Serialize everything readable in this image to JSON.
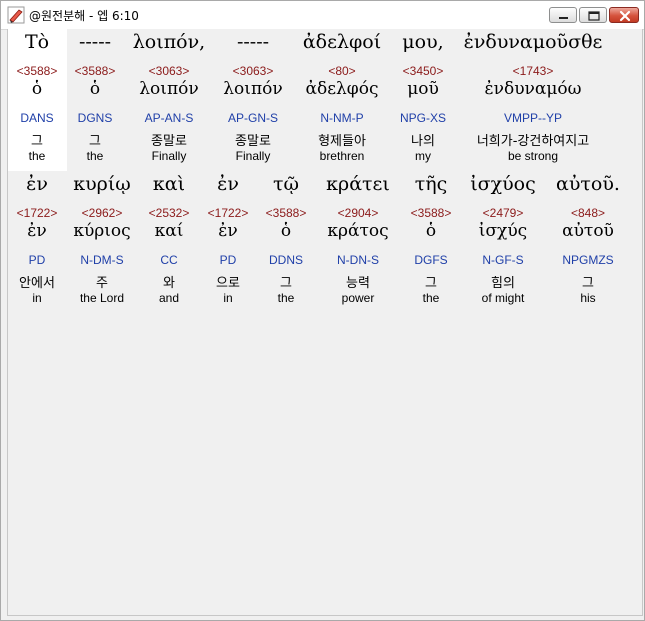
{
  "window": {
    "title": "@원전분해 - 엡 6:10"
  },
  "rows": [
    {
      "words": [
        {
          "greek": "Τὸ",
          "strong": "<3588>",
          "lemma": "ὁ",
          "parse": "DANS",
          "korean": "그",
          "english": "the"
        },
        {
          "greek": "-----",
          "strong": "<3588>",
          "lemma": "ὁ",
          "parse": "DGNS",
          "korean": "그",
          "english": "the"
        },
        {
          "greek": "λοιπόν,",
          "strong": "<3063>",
          "lemma": "λοιπόν",
          "parse": "AP-AN-S",
          "korean": "종말로",
          "english": "Finally"
        },
        {
          "greek": "-----",
          "strong": "<3063>",
          "lemma": "λοιπόν",
          "parse": "AP-GN-S",
          "korean": "종말로",
          "english": "Finally"
        },
        {
          "greek": "ἀδελφοί",
          "strong": "<80>",
          "lemma": "ἀδελφός",
          "parse": "N-NM-P",
          "korean": "형제들아",
          "english": "brethren"
        },
        {
          "greek": "μου,",
          "strong": "<3450>",
          "lemma": "μοῦ",
          "parse": "NPG-XS",
          "korean": "나의",
          "english": "my"
        },
        {
          "greek": "ἐνδυναμοῦσθε",
          "strong": "<1743>",
          "lemma": "ἐνδυναμόω",
          "parse": "VMPP--YP",
          "korean": "너희가-강건하여지고",
          "english": "be strong"
        }
      ]
    },
    {
      "words": [
        {
          "greek": "ἐν",
          "strong": "<1722>",
          "lemma": "ἐν",
          "parse": "PD",
          "korean": "안에서",
          "english": "in"
        },
        {
          "greek": "κυρίῳ",
          "strong": "<2962>",
          "lemma": "κύριος",
          "parse": "N-DM-S",
          "korean": "주",
          "english": "the Lord"
        },
        {
          "greek": "καὶ",
          "strong": "<2532>",
          "lemma": "καί",
          "parse": "CC",
          "korean": "와",
          "english": "and"
        },
        {
          "greek": "ἐν",
          "strong": "<1722>",
          "lemma": "ἐν",
          "parse": "PD",
          "korean": "으로",
          "english": "in"
        },
        {
          "greek": "τῷ",
          "strong": "<3588>",
          "lemma": "ὁ",
          "parse": "DDNS",
          "korean": "그",
          "english": "the"
        },
        {
          "greek": "κράτει",
          "strong": "<2904>",
          "lemma": "κράτος",
          "parse": "N-DN-S",
          "korean": "능력",
          "english": "power"
        },
        {
          "greek": "τῆς",
          "strong": "<3588>",
          "lemma": "ὁ",
          "parse": "DGFS",
          "korean": "그",
          "english": "the"
        },
        {
          "greek": "ἰσχύος",
          "strong": "<2479>",
          "lemma": "ἰσχύς",
          "parse": "N-GF-S",
          "korean": "힘의",
          "english": "of might"
        },
        {
          "greek": "αὐτοῦ.",
          "strong": "<848>",
          "lemma": "αὐτοῦ",
          "parse": "NPGMZS",
          "korean": "그",
          "english": "his"
        }
      ]
    }
  ],
  "icons": {
    "app": "app-icon",
    "minimize": "minimize-icon",
    "maximize": "maximize-icon",
    "close": "close-icon"
  },
  "colors": {
    "strong": "#8b1a1a",
    "parse": "#1f3fa8",
    "selected_bg": "#ffffff"
  }
}
